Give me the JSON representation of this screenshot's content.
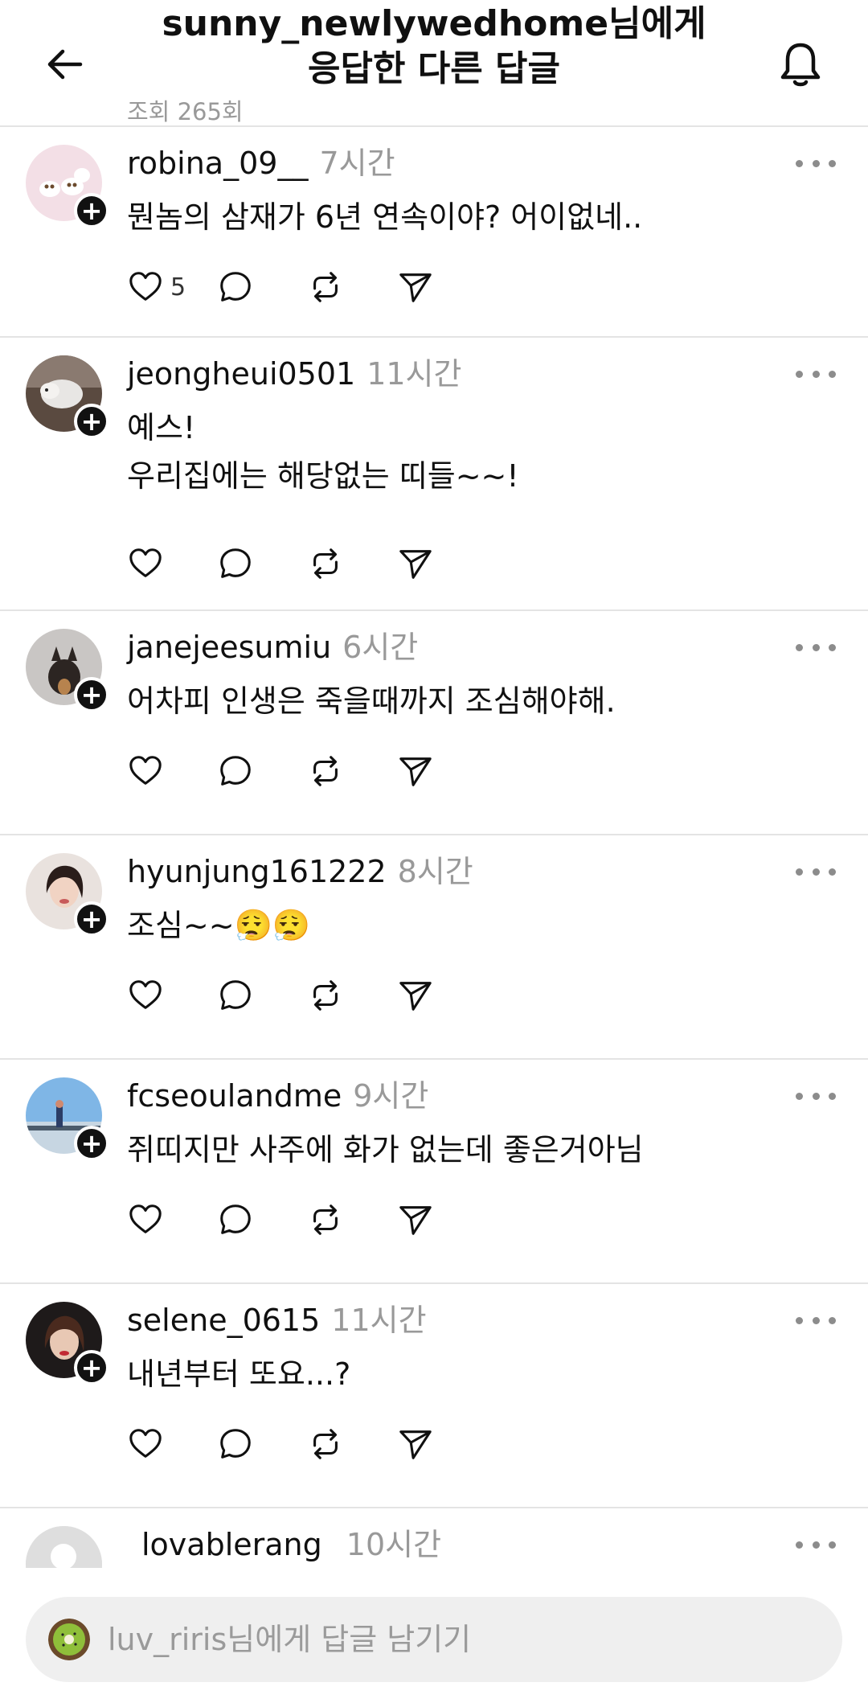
{
  "header": {
    "title_line1": "sunny_newlywedhome님에게",
    "title_line2": "응답한 다른 답글",
    "views": "조회 265회",
    "back_icon": "arrow-left-icon",
    "bell_icon": "bell-icon"
  },
  "replies": [
    {
      "username": "robina_09__",
      "time": "7시간",
      "text": "뭔놈의 삼재가 6년 연속이야? 어이없네..",
      "likes": "5"
    },
    {
      "username": "jeongheui0501",
      "time": "11시간",
      "text": "예스!\n우리집에는 해당없는 띠들~~!",
      "likes": ""
    },
    {
      "username": "janejeesumiu",
      "time": "6시간",
      "text": "어차피 인생은 죽을때까지 조심해야해.",
      "likes": ""
    },
    {
      "username": "hyunjung161222",
      "time": "8시간",
      "text": "조심~~😮‍💨😮‍💨",
      "likes": ""
    },
    {
      "username": "fcseoulandme",
      "time": "9시간",
      "text": "쥐띠지만 사주에 화가 없는데 좋은거아님",
      "likes": ""
    },
    {
      "username": "selene_0615",
      "time": "11시간",
      "text": "내년부터 또요...?",
      "likes": ""
    },
    {
      "username": "lovablerang",
      "time": "10시간",
      "text": "",
      "likes": ""
    }
  ],
  "composer": {
    "placeholder": "luv_riris님에게 답글 남기기"
  },
  "colors": {
    "text": "#101010",
    "muted": "#999999",
    "divider": "#e4e4e4",
    "input_bg": "#efefef"
  }
}
